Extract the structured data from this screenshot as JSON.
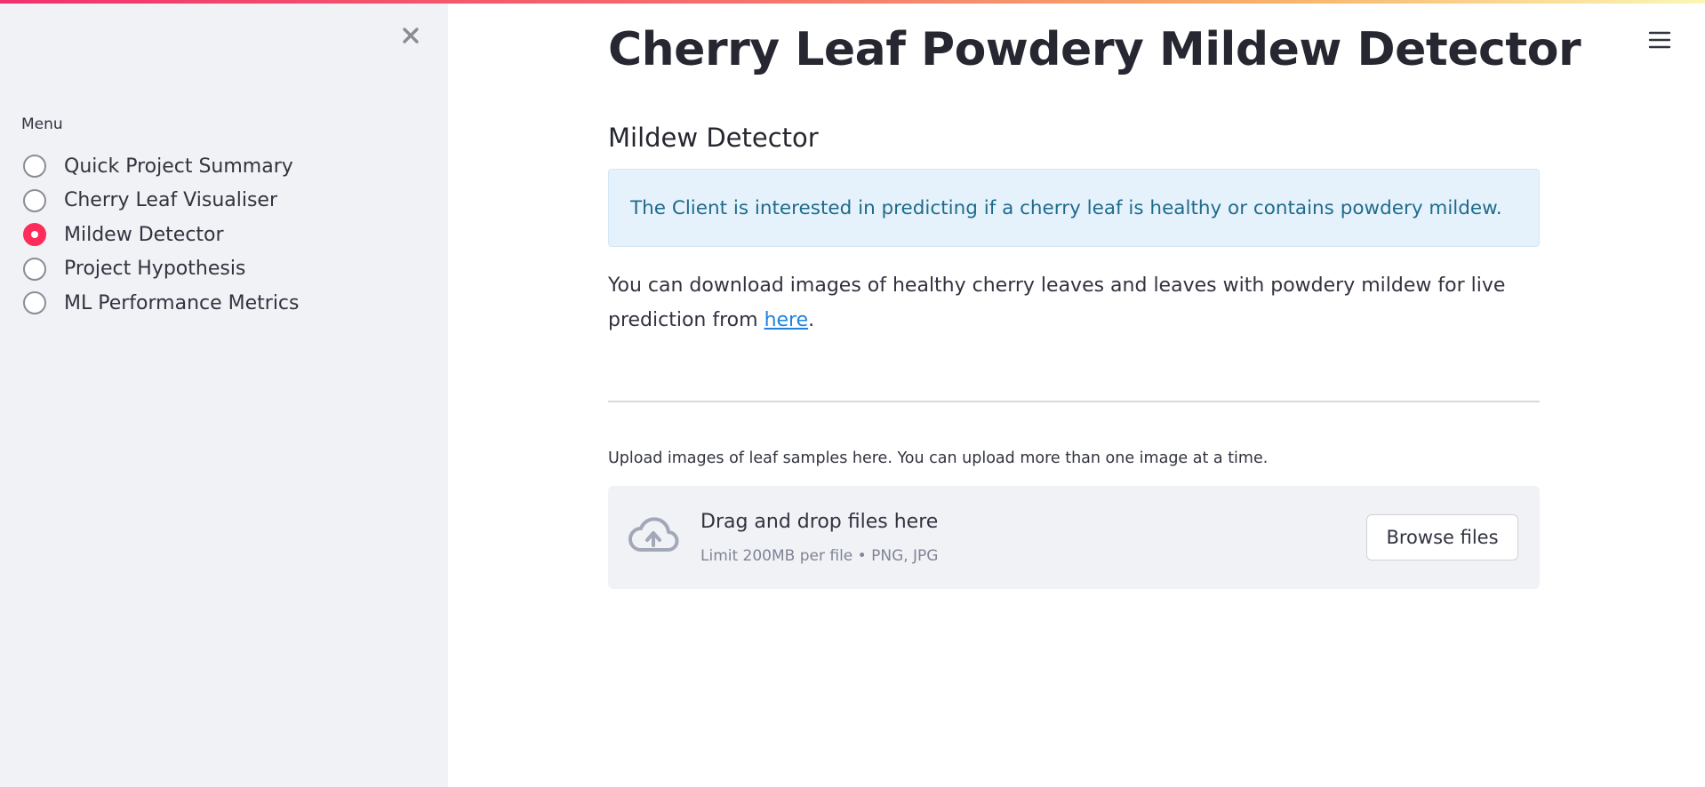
{
  "sidebar": {
    "menu_label": "Menu",
    "items": [
      {
        "label": "Quick Project Summary",
        "checked": false
      },
      {
        "label": "Cherry Leaf Visualiser",
        "checked": false
      },
      {
        "label": "Mildew Detector",
        "checked": true
      },
      {
        "label": "Project Hypothesis",
        "checked": false
      },
      {
        "label": "ML Performance Metrics",
        "checked": false
      }
    ],
    "close_icon": "close-icon"
  },
  "header": {
    "menu_icon": "hamburger-menu-icon"
  },
  "main": {
    "title": "Cherry Leaf Powdery Mildew Detector",
    "section_title": "Mildew Detector",
    "info_text": "The Client is interested in predicting if a cherry leaf is healthy or contains powdery mildew.",
    "paragraph_before_link": "You can download images of healthy cherry leaves and leaves with powdery mildew for live prediction from ",
    "link_text": "here",
    "paragraph_after_link": ".",
    "uploader": {
      "label": "Upload images of leaf samples here. You can upload more than one image at a time.",
      "drop_title": "Drag and drop files here",
      "drop_subtitle": "Limit 200MB per file • PNG, JPG",
      "browse_label": "Browse files",
      "icon": "cloud-upload-icon"
    }
  },
  "colors": {
    "accent": "#ff2b5b",
    "sidebar_bg": "#f0f2f6",
    "info_bg": "#e6f2fb",
    "info_text": "#1f6b8c",
    "link": "#1c83e1"
  }
}
